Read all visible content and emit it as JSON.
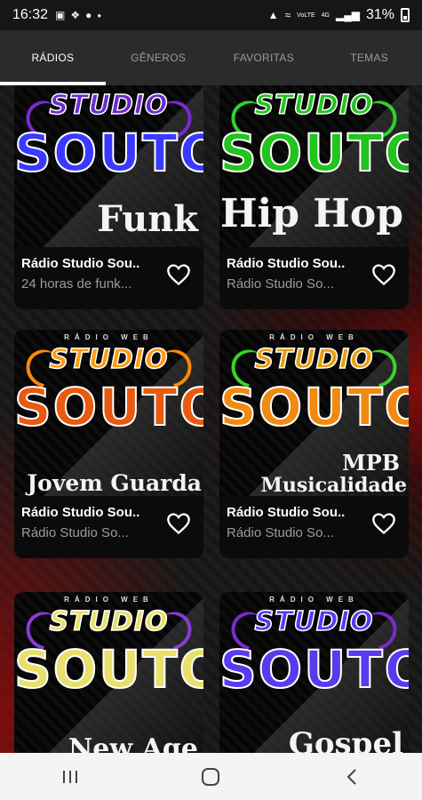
{
  "status": {
    "time": "16:32",
    "network_label": "VoLTE",
    "network_sub": "4G",
    "battery": "31%",
    "left_icons": [
      "image-icon",
      "app-icon",
      "location-icon",
      "dot-icon"
    ],
    "right_icons": [
      "alarm-icon",
      "wifi-icon",
      "signal-icon",
      "battery-icon"
    ]
  },
  "tabs": [
    {
      "label": "RÁDIOS",
      "active": true
    },
    {
      "label": "GÊNEROS",
      "active": false
    },
    {
      "label": "FAVORITAS",
      "active": false
    },
    {
      "label": "TEMAS",
      "active": false
    }
  ],
  "cards": [
    {
      "art": {
        "web_label": "",
        "studio": "STUDIO",
        "souto": "SOUTO",
        "genre_line1": "",
        "genre_line2": "Funk",
        "accent": "#7a2ad1",
        "fill": "#3a3aff"
      },
      "title": "Rádio Studio Sou..",
      "subtitle": "24 horas de funk...",
      "favorite_icon": "heart-outline-icon"
    },
    {
      "art": {
        "web_label": "",
        "studio": "STUDIO",
        "souto": "SOUTO",
        "genre_line1": "",
        "genre_line2": "Hip Hop",
        "accent": "#2fd12f",
        "fill": "#22c41e"
      },
      "title": "Rádio Studio Sou..",
      "subtitle": "Rádio Studio So...",
      "favorite_icon": "heart-outline-icon"
    },
    {
      "art": {
        "web_label": "RÁDIO WEB",
        "studio": "STUDIO",
        "souto": "SOUTO",
        "genre_line1": "",
        "genre_line2": "Jovem Guarda",
        "accent": "#ff8a00",
        "fill": "#e85a10"
      },
      "title": "Rádio Studio Sou..",
      "subtitle": "Rádio Studio So...",
      "favorite_icon": "heart-outline-icon"
    },
    {
      "art": {
        "web_label": "RÁDIO WEB",
        "studio": "STUDIO",
        "souto": "SOUTO",
        "genre_line1": "MPB",
        "genre_line2": "Musicalidade",
        "accent": "#3bd12c",
        "fill": "#f08a10"
      },
      "title": "Rádio Studio Sou..",
      "subtitle": "Rádio Studio So...",
      "favorite_icon": "heart-outline-icon"
    },
    {
      "art": {
        "web_label": "RÁDIO WEB",
        "studio": "STUDIO",
        "souto": "SOUTO",
        "genre_line1": "",
        "genre_line2": "New Age",
        "accent": "#8a3ad6",
        "fill": "#e8e06a"
      },
      "title": "",
      "subtitle": "",
      "favorite_icon": "heart-outline-icon"
    },
    {
      "art": {
        "web_label": "RÁDIO WEB",
        "studio": "STUDIO",
        "souto": "SOUTO",
        "genre_line1": "",
        "genre_line2": "Gospel",
        "accent": "#7a2ad1",
        "fill": "#5a3aef"
      },
      "title": "",
      "subtitle": "",
      "favorite_icon": "heart-outline-icon"
    }
  ],
  "nav": [
    "recents-icon",
    "home-icon",
    "back-icon"
  ]
}
